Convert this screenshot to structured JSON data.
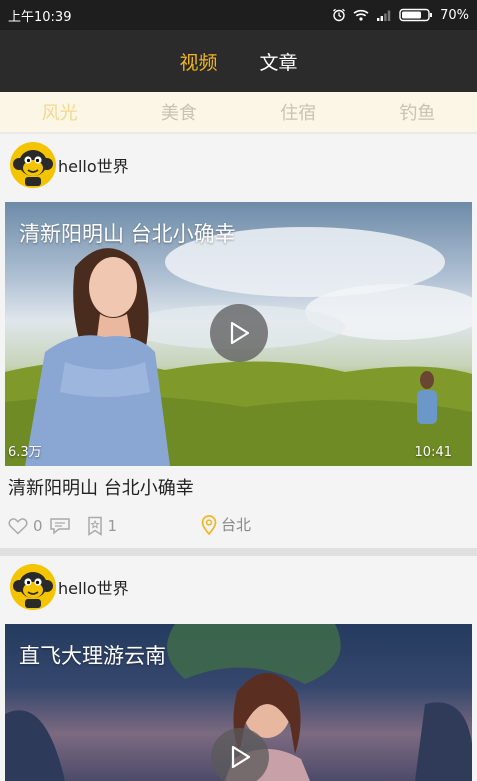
{
  "status_bar": {
    "time": "上午10:39",
    "battery": "70%",
    "icons": [
      "alarm-icon",
      "wifi-icon",
      "signal-icon",
      "battery-icon"
    ]
  },
  "header": {
    "tabs": [
      {
        "label": "视频",
        "active": true
      },
      {
        "label": "文章",
        "active": false
      }
    ]
  },
  "categories": [
    {
      "label": "风光",
      "active": true
    },
    {
      "label": "美食",
      "active": false
    },
    {
      "label": "住宿",
      "active": false
    },
    {
      "label": "钓鱼",
      "active": false
    }
  ],
  "feed": [
    {
      "author": "hello世界",
      "video_title": "清新阳明山 台北小确幸",
      "views": "6.3万",
      "duration": "10:41",
      "caption": "清新阳明山 台北小确幸",
      "likes": "0",
      "favorites": "1",
      "location": "台北"
    },
    {
      "author": "hello世界",
      "video_title": "直飞大理游云南"
    }
  ],
  "colors": {
    "accent": "#f0b521",
    "header_bg": "#2b2b2b",
    "category_bg": "#fbf6e5",
    "location_icon": "#f0b521"
  }
}
